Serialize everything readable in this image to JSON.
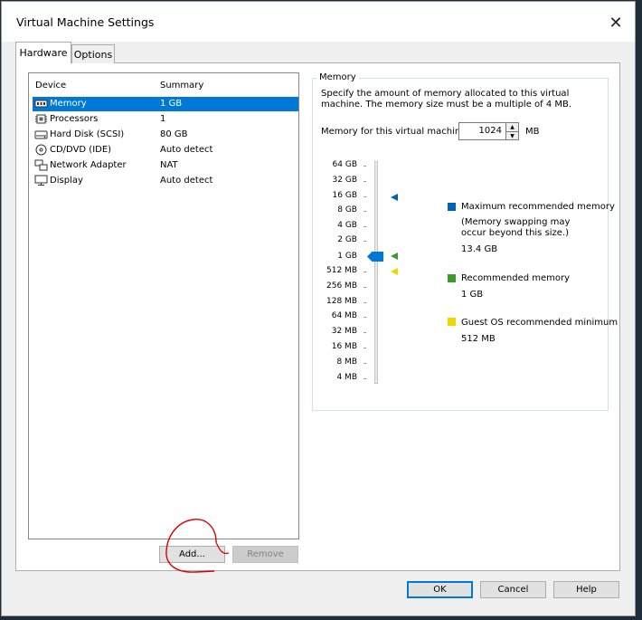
{
  "window": {
    "title": "Virtual Machine Settings",
    "close": "✕"
  },
  "tabs": [
    {
      "label": "Hardware"
    },
    {
      "label": "Options"
    }
  ],
  "device_list": {
    "headers": {
      "device": "Device",
      "summary": "Summary"
    },
    "rows": [
      {
        "device": "Memory",
        "summary": "1 GB",
        "icon": "memory-icon"
      },
      {
        "device": "Processors",
        "summary": "1",
        "icon": "processor-icon"
      },
      {
        "device": "Hard Disk (SCSI)",
        "summary": "80 GB",
        "icon": "hard-disk-icon"
      },
      {
        "device": "CD/DVD (IDE)",
        "summary": "Auto detect",
        "icon": "cd-dvd-icon"
      },
      {
        "device": "Network Adapter",
        "summary": "NAT",
        "icon": "network-adapter-icon"
      },
      {
        "device": "Display",
        "summary": "Auto detect",
        "icon": "display-icon"
      }
    ],
    "selected_index": 0
  },
  "buttons": {
    "add": "Add...",
    "remove": "Remove",
    "ok": "OK",
    "cancel": "Cancel",
    "help": "Help"
  },
  "memory": {
    "group_label": "Memory",
    "description": "Specify the amount of memory allocated to this virtual machine. The memory size must be a multiple of 4 MB.",
    "field_label": "Memory for this virtual machine:",
    "value": "1024",
    "unit": "MB",
    "scale": [
      "64 GB",
      "32 GB",
      "16 GB",
      "8 GB",
      "4 GB",
      "2 GB",
      "1 GB",
      "512 MB",
      "256 MB",
      "128 MB",
      "64 MB",
      "32 MB",
      "16 MB",
      "8 MB",
      "4 MB"
    ],
    "legend": {
      "max_title": "Maximum recommended memory",
      "max_note": "(Memory swapping may occur beyond this size.)",
      "max_value": "13.4 GB",
      "rec_title": "Recommended memory",
      "rec_value": "1 GB",
      "min_title": "Guest OS recommended minimum",
      "min_value": "512 MB"
    },
    "colors": {
      "max": "#0063b1",
      "rec": "#3a9a2a",
      "min": "#f2d600",
      "slider": "#0078d7"
    }
  }
}
